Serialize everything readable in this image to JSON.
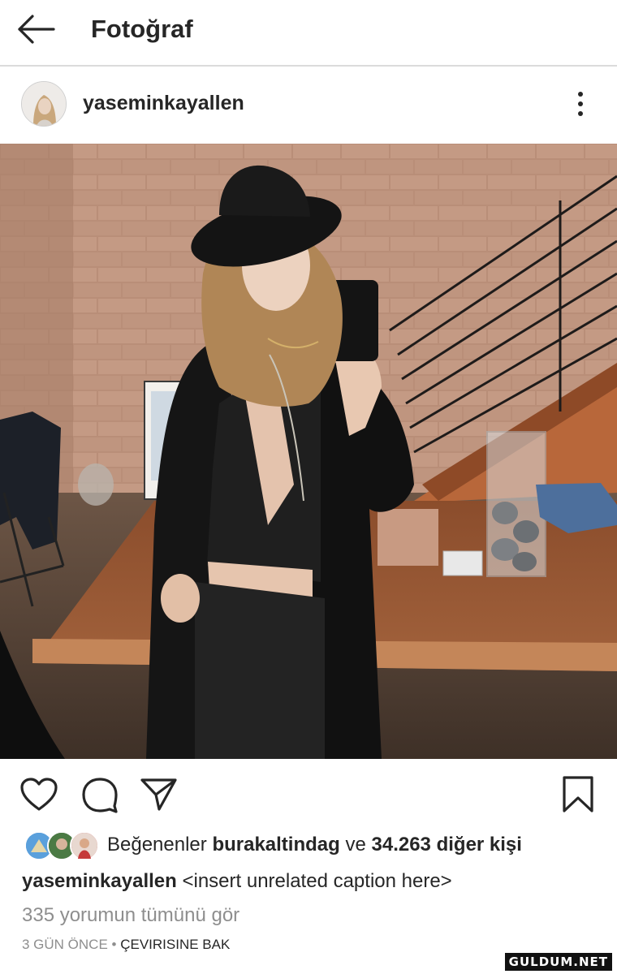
{
  "topbar": {
    "title": "Fotoğraf"
  },
  "post": {
    "username": "yaseminkayallen",
    "photo_alt": "Mirror selfie in a brick-walled room",
    "likes": {
      "prefix": "Beğenenler",
      "user": "burakaltindag",
      "conjunction": "ve",
      "others": "34.263 diğer kişi"
    },
    "caption": {
      "username": "yaseminkayallen",
      "text": "<insert unrelated caption here>"
    },
    "view_comments": "335 yorumun tümünü gör",
    "time": "3 GÜN ÖNCE",
    "separator": "•",
    "translate": "ÇEVIRISINE BAK"
  },
  "watermark": "GULDUM.NET",
  "icons": [
    "back-arrow-icon",
    "more-options-icon",
    "heart-icon",
    "comment-icon",
    "share-icon",
    "bookmark-icon"
  ],
  "colors": {
    "text": "#262626",
    "secondary": "#8e8e8e",
    "divider": "#dbdbdb"
  }
}
